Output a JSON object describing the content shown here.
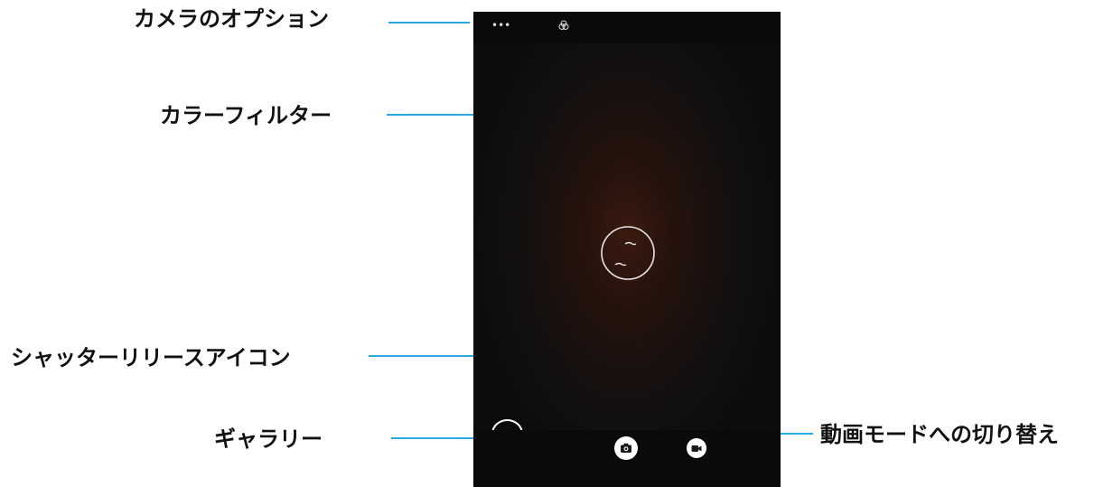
{
  "callouts": {
    "camera_options": "カメラのオプション",
    "color_filter": "カラーフィルター",
    "shutter_release": "シャッターリリースアイコン",
    "gallery": "ギャラリー",
    "switch_video": "動画モードへの切り替え"
  },
  "camera": {
    "options_glyph": "•••"
  },
  "colors": {
    "callout_line": "#29abe2",
    "viewfinder_glow": "#3a1a10"
  },
  "icons": [
    "more-options-icon",
    "color-filter-icon",
    "focus-ring-icon",
    "gallery-thumbnail-icon",
    "camera-shutter-icon",
    "video-camera-icon"
  ]
}
